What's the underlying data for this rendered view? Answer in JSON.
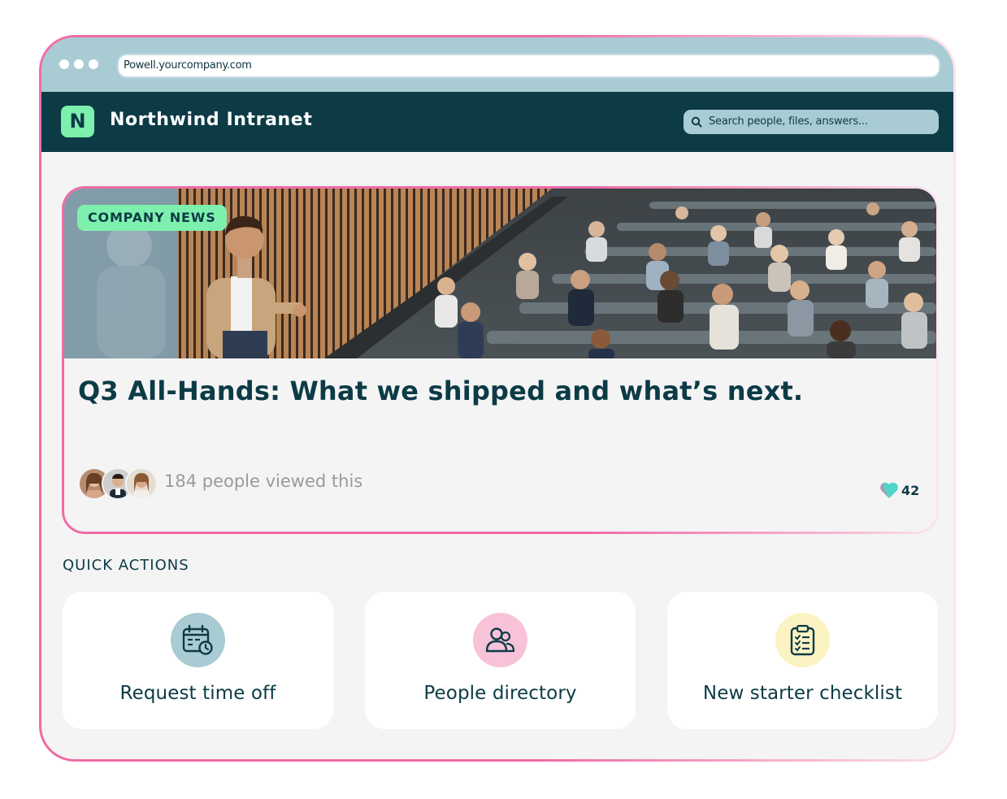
{
  "browser": {
    "url": "Powell.yourcompany.com"
  },
  "app": {
    "logo_letter": "N",
    "title": "Northwind Intranet",
    "search_placeholder": "Search people, files, answers..."
  },
  "news_card": {
    "badge": "COMPANY NEWS",
    "headline": "Q3 All-Hands: What we shipped and what’s next.",
    "viewed_text": "184 people viewed this",
    "likes": "42"
  },
  "quick_actions": {
    "title": "QUICK ACTIONS",
    "items": [
      {
        "label": "Request time off",
        "icon": "calendar-clock-icon",
        "color": "#a9cbd3"
      },
      {
        "label": "People directory",
        "icon": "people-icon",
        "color": "#f8c2d8"
      },
      {
        "label": "New starter checklist",
        "icon": "clipboard-checklist-icon",
        "color": "#fbf3c2"
      }
    ]
  },
  "colors": {
    "dark_teal": "#0c3b46",
    "mint": "#7ef0ae",
    "pink_border": "#f06ca5",
    "light_blue": "#a9cbd3",
    "heart": "#4fd6c9"
  }
}
